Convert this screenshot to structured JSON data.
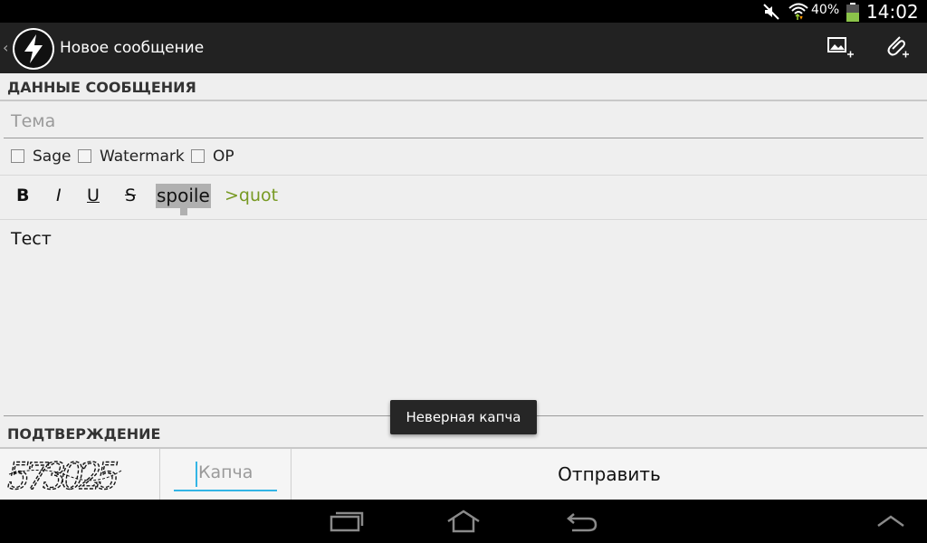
{
  "status_bar": {
    "battery": "40%",
    "time": "14:02"
  },
  "action_bar": {
    "up_glyph": "‹",
    "title": "Новое сообщение"
  },
  "sections": {
    "message_data": "ДАННЫЕ СООБЩЕНИЯ",
    "confirmation": "ПОДТВЕРЖДЕНИЕ"
  },
  "form": {
    "subject_placeholder": "Тема",
    "checkboxes": [
      "Sage",
      "Watermark",
      "OP"
    ],
    "format": {
      "bold": "B",
      "italic": "I",
      "underline": "U",
      "strike": "S",
      "spoiler": "spoile",
      "quote": ">quot"
    },
    "message": "Тест",
    "captcha_placeholder": "Капча",
    "captcha_image_text": "573025",
    "send_label": "Отправить"
  },
  "toast": "Неверная капча",
  "colors": {
    "accent": "#33b5e5",
    "quote": "#779922"
  }
}
